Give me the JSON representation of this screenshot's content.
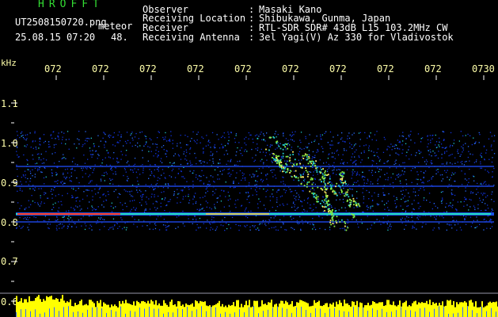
{
  "colors": {
    "brand": "#33dd33",
    "header_text": "#ffffff",
    "tick_label": "#ffffaa",
    "axis_label": "#ffffaa",
    "background": "#000000",
    "carrier": "#ff3a1a",
    "echo": "#88ee44",
    "noise": "#1133dd",
    "power_bar": "#ffff00"
  },
  "header": {
    "brand": "HROFFT",
    "filename": "UT2508150720.png",
    "detection": "meteor",
    "datetime": "25.08.15 07:20",
    "count": "48.",
    "fields": [
      {
        "label": "Observer",
        "sep": ":",
        "value": "Masaki Kano"
      },
      {
        "label": "Receiving Location",
        "sep": ":",
        "value": "Shibukawa, Gunma, Japan"
      },
      {
        "label": "Receiver",
        "sep": ":",
        "value": "RTL-SDR SDR# 43dB L15 103.2MHz CW"
      },
      {
        "label": "Receiving Antenna",
        "sep": ":",
        "value": "3el Yagi(V) Az 330 for Vladivostok"
      }
    ]
  },
  "axis": {
    "unit": "kHz",
    "y_ticks": [
      "1.1",
      "1.0",
      "0.9",
      "0.8",
      "0.7",
      "0.6"
    ],
    "x_ticks": [
      "072",
      "072",
      "072",
      "072",
      "072",
      "072",
      "072",
      "072",
      "072",
      "0730"
    ]
  },
  "spectrogram": {
    "time_range": [
      "07:20",
      "07:30"
    ],
    "freq_range_khz": [
      0.6,
      1.15
    ],
    "carrier_khz": 0.82,
    "meteor_echo_time": "07:25"
  }
}
